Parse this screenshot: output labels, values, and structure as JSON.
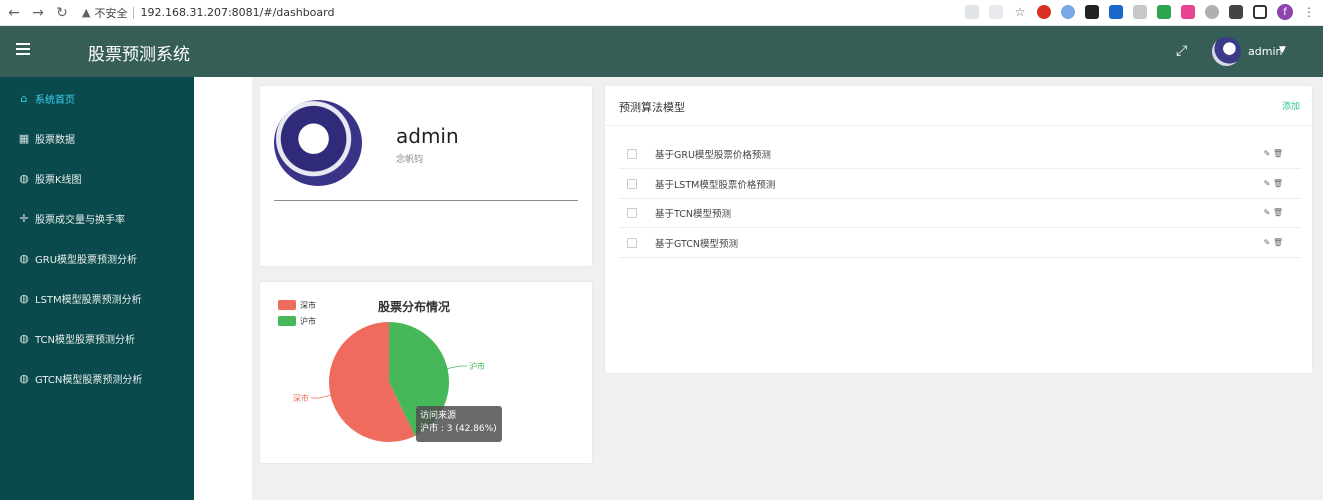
{
  "browser": {
    "security_label": "不安全",
    "url": "192.168.31.207:8081/#/dashboard",
    "profile_initial": "f"
  },
  "header": {
    "title": "股票预测系统",
    "username": "admin"
  },
  "sidebar": {
    "items": [
      {
        "label": "系统首页",
        "icon": "home-icon",
        "active": true
      },
      {
        "label": "股票数据",
        "icon": "grid-icon",
        "active": false
      },
      {
        "label": "股票K线图",
        "icon": "chart-icon",
        "active": false
      },
      {
        "label": "股票成交量与换手率",
        "icon": "move-icon",
        "active": false
      },
      {
        "label": "GRU模型股票预测分析",
        "icon": "chart-icon",
        "active": false
      },
      {
        "label": "LSTM模型股票预测分析",
        "icon": "chart-icon",
        "active": false
      },
      {
        "label": "TCN模型股票预测分析",
        "icon": "chart-icon",
        "active": false
      },
      {
        "label": "GTCN模型股票预测分析",
        "icon": "chart-icon",
        "active": false
      }
    ]
  },
  "profile": {
    "name": "admin",
    "subtitle": "念帆钧"
  },
  "models": {
    "title": "预测算法模型",
    "add_label": "添加",
    "rows": [
      {
        "label": "基于GRU模型股票价格预测",
        "actions": "✎ 🗑"
      },
      {
        "label": "基于LSTM模型股票价格预测",
        "actions": "✎ 🗑"
      },
      {
        "label": "基于TCN模型预测",
        "actions": "✎ 🗑"
      },
      {
        "label": "基于GTCN模型预测",
        "actions": "✎ 🗑"
      }
    ]
  },
  "chart_data": {
    "type": "pie",
    "title": "股票分布情况",
    "series": [
      {
        "name": "深市",
        "value": 4,
        "color": "#ee6b5e"
      },
      {
        "name": "沪市",
        "value": 3,
        "color": "#46b85a"
      }
    ],
    "legend_position": "top-left",
    "tooltip": {
      "title": "访问来源",
      "text": "沪市 : 3 (42.86%)"
    }
  }
}
